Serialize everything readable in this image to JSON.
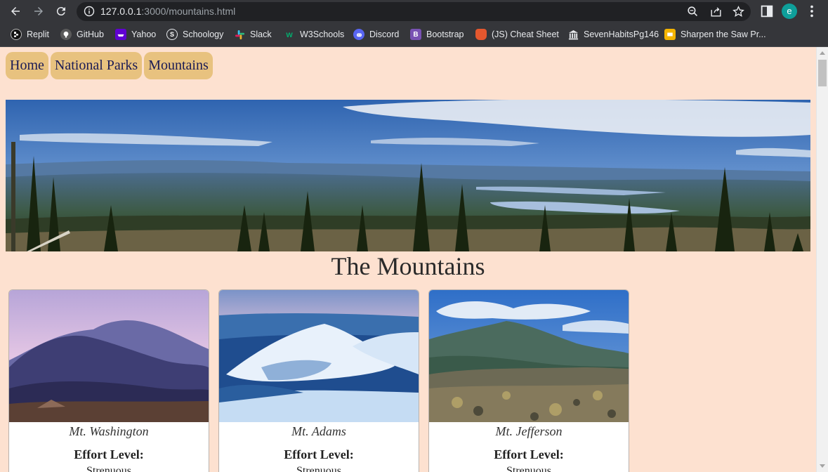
{
  "browser": {
    "url_host": "127.0.0.1",
    "url_path": ":3000/mountains.html",
    "profile_initial": "e"
  },
  "bookmarks": [
    {
      "label": "Replit",
      "icon": "replit-icon",
      "color": "#111111"
    },
    {
      "label": "GitHub",
      "icon": "github-icon",
      "color": "#24292e"
    },
    {
      "label": "Yahoo",
      "icon": "yahoo-icon",
      "color": "#6001d2"
    },
    {
      "label": "Schoology",
      "icon": "schoology-icon",
      "color": "#2c6a8e"
    },
    {
      "label": "Slack",
      "icon": "slack-icon",
      "color": "#e01e5a"
    },
    {
      "label": "W3Schools",
      "icon": "w3schools-icon",
      "color": "#04aa6d"
    },
    {
      "label": "Discord",
      "icon": "discord-icon",
      "color": "#5865f2"
    },
    {
      "label": "Bootstrap",
      "icon": "bootstrap-icon",
      "color": "#7952b3"
    },
    {
      "label": "(JS) Cheat Sheet",
      "icon": "cheatsheet-icon",
      "color": "#e4572e"
    },
    {
      "label": "SevenHabitsPg146",
      "icon": "building-icon",
      "color": "#e8eaed"
    },
    {
      "label": "Sharpen the Saw Pr...",
      "icon": "slides-icon",
      "color": "#f4b400"
    }
  ],
  "nav": {
    "items": [
      "Home",
      "National Parks",
      "Mountains"
    ]
  },
  "page": {
    "title": "The Mountains"
  },
  "cards": [
    {
      "name": "Mt. Washington",
      "effort_label": "Effort Level:",
      "effort_value": "Strenuous"
    },
    {
      "name": "Mt. Adams",
      "effort_label": "Effort Level:",
      "effort_value": "Strenuous"
    },
    {
      "name": "Mt. Jefferson",
      "effort_label": "Effort Level:",
      "effort_value": "Strenuous"
    }
  ],
  "colors": {
    "page_bg": "#fde1d0",
    "nav_button": "#e8c27f",
    "nav_text": "#1a1a55",
    "chrome_bg": "#35363a"
  }
}
